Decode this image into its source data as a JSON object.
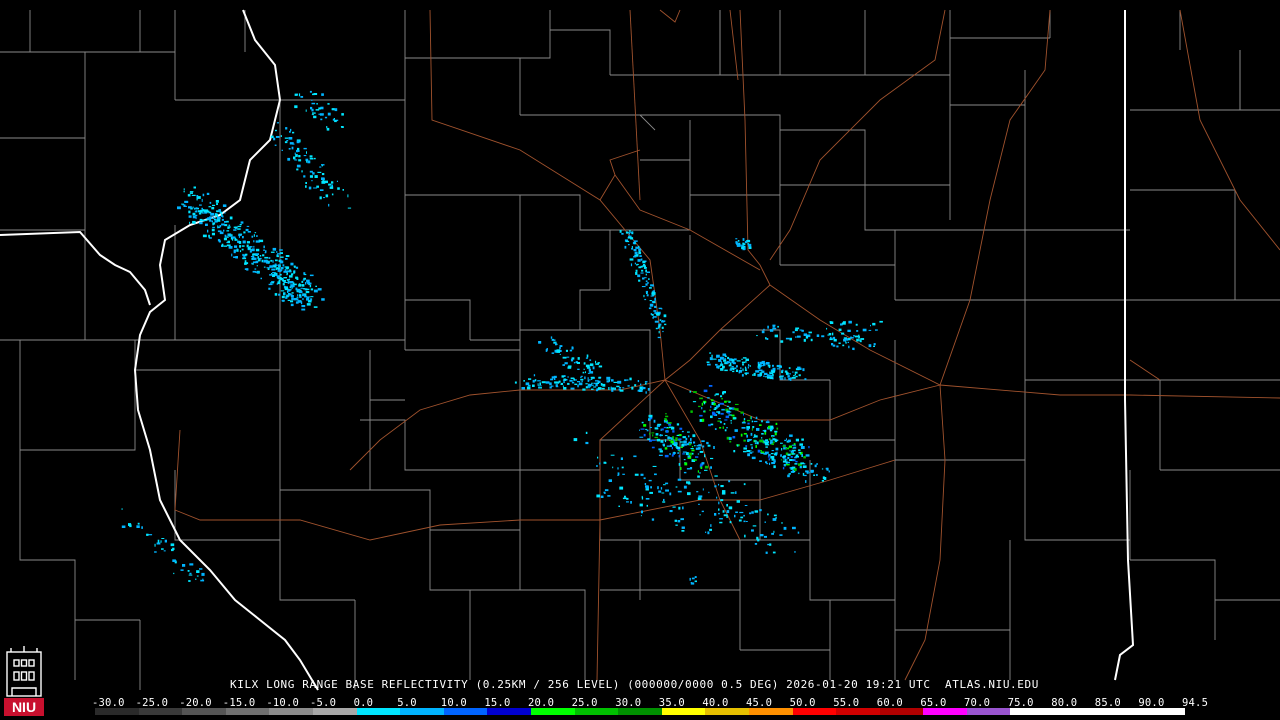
{
  "product_title": "KILX LONG RANGE BASE REFLECTIVITY (0.25KM / 256 LEVEL) (000000/0000 0.5 DEG) 2026-01-20 19:21 UTC  ATLAS.NIU.EDU",
  "logo": {
    "text": "NIU",
    "color": "#c8102e"
  },
  "colorbar": {
    "tick_labels": [
      "-30.0",
      "-25.0",
      "-20.0",
      "-15.0",
      "-10.0",
      "-5.0",
      "0.0",
      "5.0",
      "10.0",
      "15.0",
      "20.0",
      "25.0",
      "30.0",
      "35.0",
      "40.0",
      "45.0",
      "50.0",
      "55.0",
      "60.0",
      "65.0",
      "70.0",
      "75.0",
      "80.0",
      "85.0",
      "90.0",
      "94.5"
    ],
    "colors": [
      "#2a2a2a",
      "#3a3a3a",
      "#555555",
      "#707070",
      "#8c8c8c",
      "#a8a8a8",
      "#00e6ff",
      "#00b4ff",
      "#0064ff",
      "#0000d0",
      "#00ff00",
      "#00c000",
      "#009000",
      "#ffff00",
      "#e6c000",
      "#ff9000",
      "#ff0000",
      "#d00000",
      "#b00000",
      "#ff00ff",
      "#9a55d0",
      "#ffffff",
      "#ffffff",
      "#ffffff",
      "#ffffff"
    ]
  },
  "map_style": {
    "county_line": "#8a8a8a",
    "state_line": "#ffffff",
    "road_line": "#a0522d"
  }
}
